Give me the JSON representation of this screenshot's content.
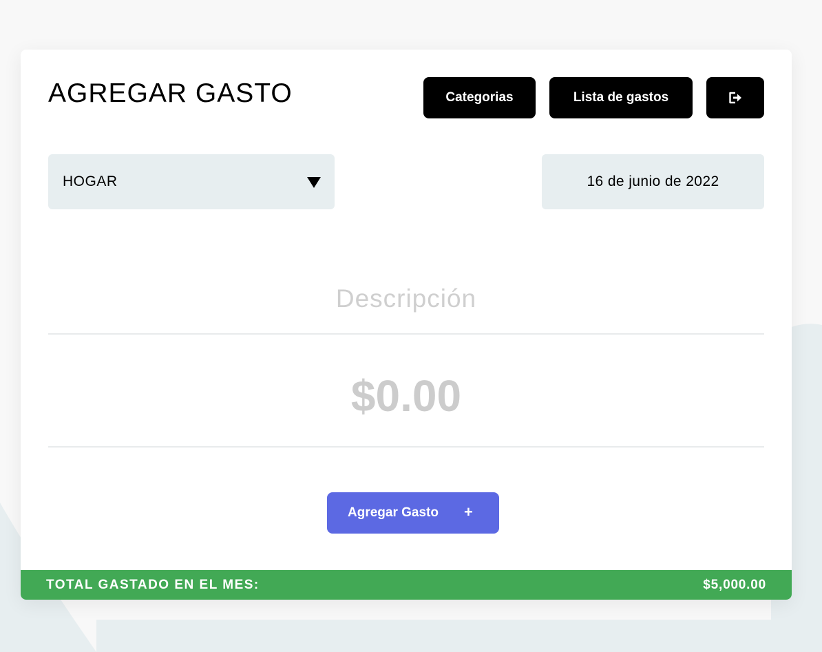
{
  "header": {
    "title": "AGREGAR GASTO",
    "nav": {
      "categories_label": "Categorias",
      "expenses_list_label": "Lista de gastos",
      "logout_icon": "logout-icon"
    }
  },
  "form": {
    "category": {
      "selected": "HOGAR",
      "icon": "caret-down-icon"
    },
    "date": "16 de junio de 2022",
    "description": {
      "value": "",
      "placeholder": "Descripción"
    },
    "amount": {
      "value": "",
      "placeholder": "$0.00"
    },
    "submit": {
      "label": "Agregar Gasto",
      "icon_glyph": "+"
    }
  },
  "footer": {
    "total_label": "TOTAL GASTADO EN EL MES:",
    "total_value": "$5,000.00"
  },
  "colors": {
    "page_background": "#f8f8f8",
    "background_shape": "#e7eef0",
    "field_background": "#e7eef0",
    "primary_button": "#000000",
    "submit_button": "#5c69e3",
    "total_bar": "#42a955",
    "placeholder": "#cccccc"
  }
}
